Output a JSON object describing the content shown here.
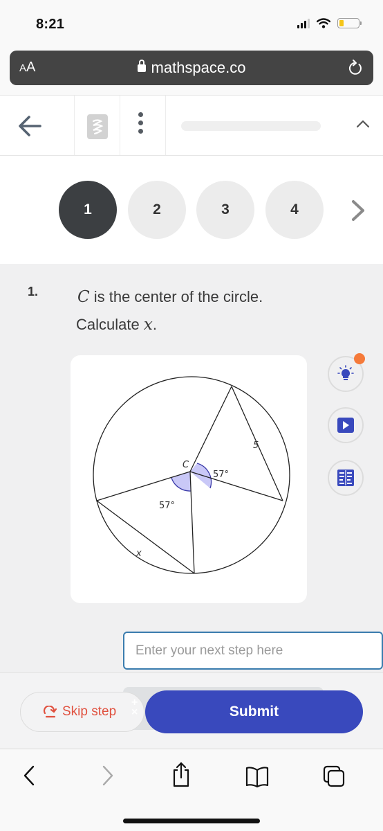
{
  "status_bar": {
    "time": "8:21",
    "icons": [
      "cellular-signal-icon",
      "wifi-icon",
      "battery-low-icon"
    ],
    "battery_color": "#f5c518"
  },
  "url_bar": {
    "text_size_label": "AA",
    "url": "mathspace.co",
    "icons": [
      "lock-icon",
      "reload-icon"
    ]
  },
  "top_nav": {
    "icons": [
      "back-arrow-icon",
      "mathspace-logo-icon",
      "more-vertical-icon",
      "chevron-up-icon"
    ]
  },
  "pager": {
    "questions": [
      {
        "label": "1",
        "active": true
      },
      {
        "label": "2",
        "active": false
      },
      {
        "label": "3",
        "active": false
      },
      {
        "label": "4",
        "active": false
      }
    ],
    "next_icon": "chevron-right-icon"
  },
  "question": {
    "number": "1.",
    "line1_var": "C",
    "line1_text": " is the center of the circle.",
    "line2_text": "Calculate ",
    "line2_var": "x",
    "line2_end": "."
  },
  "diagram": {
    "center_label": "C",
    "angle_top_label": "57°",
    "angle_bottom_label": "57°",
    "chord_top_label": "5",
    "chord_bottom_label": "x",
    "angle_fill": "#c9c8f7",
    "angle_stroke": "#3a3aa8"
  },
  "side_tools": [
    {
      "name": "hint",
      "icon": "lightbulb-icon",
      "has_badge": true
    },
    {
      "name": "video",
      "icon": "play-video-icon",
      "has_badge": false
    },
    {
      "name": "worked-example",
      "icon": "book-icon",
      "has_badge": false
    }
  ],
  "input": {
    "placeholder": "Enter your next step here",
    "value": ""
  },
  "actions": {
    "skip_label": "Skip step",
    "submit_label": "Submit",
    "keypad_glyph": "+\n×",
    "colors": {
      "skip": "#e0513f",
      "submit": "#3949bd"
    }
  },
  "browser_toolbar": {
    "icons": [
      "back-icon",
      "forward-icon",
      "share-icon",
      "bookmarks-icon",
      "tabs-icon"
    ]
  }
}
